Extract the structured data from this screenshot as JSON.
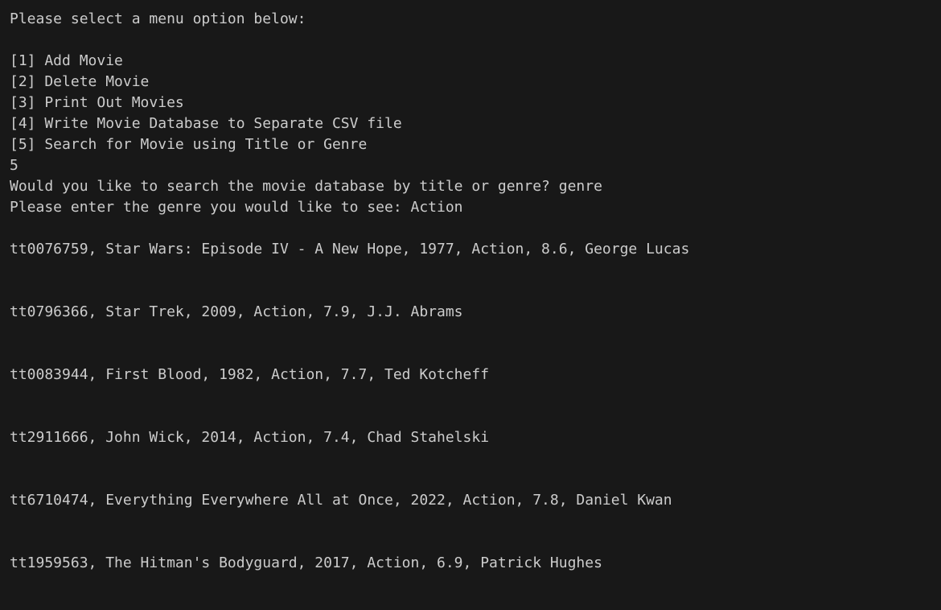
{
  "terminal": {
    "prompt": "Please select a menu option below:",
    "menu_items": [
      "[1] Add Movie",
      "[2] Delete Movie",
      "[3] Print Out Movies",
      "[4] Write Movie Database to Separate CSV file",
      "[5] Search for Movie using Title or Genre"
    ],
    "user_choice": "5",
    "search_question": "Would you like to search the movie database by title or genre? genre",
    "genre_question": "Please enter the genre you would like to see: Action",
    "results": [
      "tt0076759, Star Wars: Episode IV - A New Hope, 1977, Action, 8.6, George Lucas",
      "tt0796366, Star Trek, 2009, Action, 7.9, J.J. Abrams",
      "tt0083944, First Blood, 1982, Action, 7.7, Ted Kotcheff",
      "tt2911666, John Wick, 2014, Action, 7.4, Chad Stahelski",
      "tt6710474, Everything Everywhere All at Once, 2022, Action, 7.8, Daniel Kwan",
      "tt1959563, The Hitman's Bodyguard, 2017, Action, 6.9, Patrick Hughes"
    ]
  },
  "colors": {
    "background": "#181818",
    "text": "#cccccc"
  }
}
